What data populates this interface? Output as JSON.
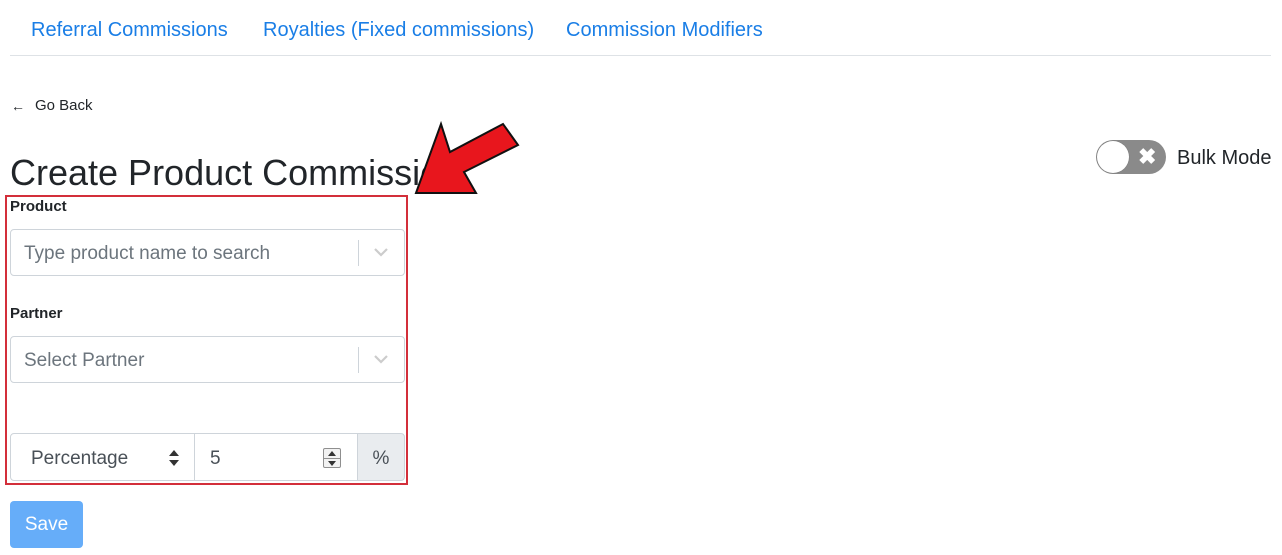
{
  "tabs": [
    {
      "label": "Referral Commissions"
    },
    {
      "label": "Royalties (Fixed commissions)"
    },
    {
      "label": "Commission Modifiers"
    }
  ],
  "back": {
    "arrow": "←",
    "label": "Go Back"
  },
  "page": {
    "title": "Create Product Commission"
  },
  "bulk_mode": {
    "label": "Bulk Mode",
    "enabled": false,
    "icon": "x-icon"
  },
  "form": {
    "product": {
      "label": "Product",
      "placeholder": "Type product name to search"
    },
    "partner": {
      "label": "Partner",
      "placeholder": "Select Partner"
    },
    "commission": {
      "type_value": "Percentage",
      "amount_value": "5",
      "unit": "%"
    },
    "save_label": "Save"
  },
  "colors": {
    "link": "#1a7ee6",
    "highlight_border": "#d32f3a",
    "annotation_arrow": "#e8161d",
    "save_button": "#66adf9",
    "toggle_off": "#8a8a8a"
  }
}
